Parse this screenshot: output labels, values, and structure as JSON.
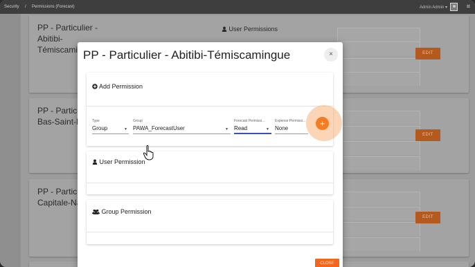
{
  "breadcrumb": {
    "root": "Security",
    "separator": "/",
    "current": "Permissions (Forecast)"
  },
  "user": {
    "name": "Admin Admin",
    "caret": "▾"
  },
  "menu_glyph": "≡",
  "cards": [
    {
      "title": "PP - Particulier - Abitibi-Témiscamingue",
      "section": "User Permissions",
      "edit_label": "EDIT"
    },
    {
      "title": "PP - Particulier - Bas-Saint-Laurent",
      "edit_label": "EDIT"
    },
    {
      "title": "PP - Particulier - Capitale-Nationale",
      "edit_label": "EDIT"
    }
  ],
  "modal": {
    "title": "PP - Particulier - Abitibi-Témiscamingue",
    "close_x": "×",
    "add_permission": {
      "title": "Add Permission",
      "fields": {
        "type": {
          "label": "Type",
          "value": "Group"
        },
        "group": {
          "label": "Group",
          "value": "PAWA_ForecastUser"
        },
        "forecast": {
          "label": "Forecast Permissi...",
          "value": "Read"
        },
        "expense": {
          "label": "Expense Permissi...",
          "value": "None"
        }
      },
      "add_glyph": "+"
    },
    "user_permission": {
      "title": "User Permission"
    },
    "group_permission": {
      "title": "Group Permission"
    },
    "close_label": "CLOSE"
  },
  "colors": {
    "accent": "#f57c20",
    "edit_button_dimmed": "#b45a1e",
    "topbar": "#3e3e3e"
  }
}
